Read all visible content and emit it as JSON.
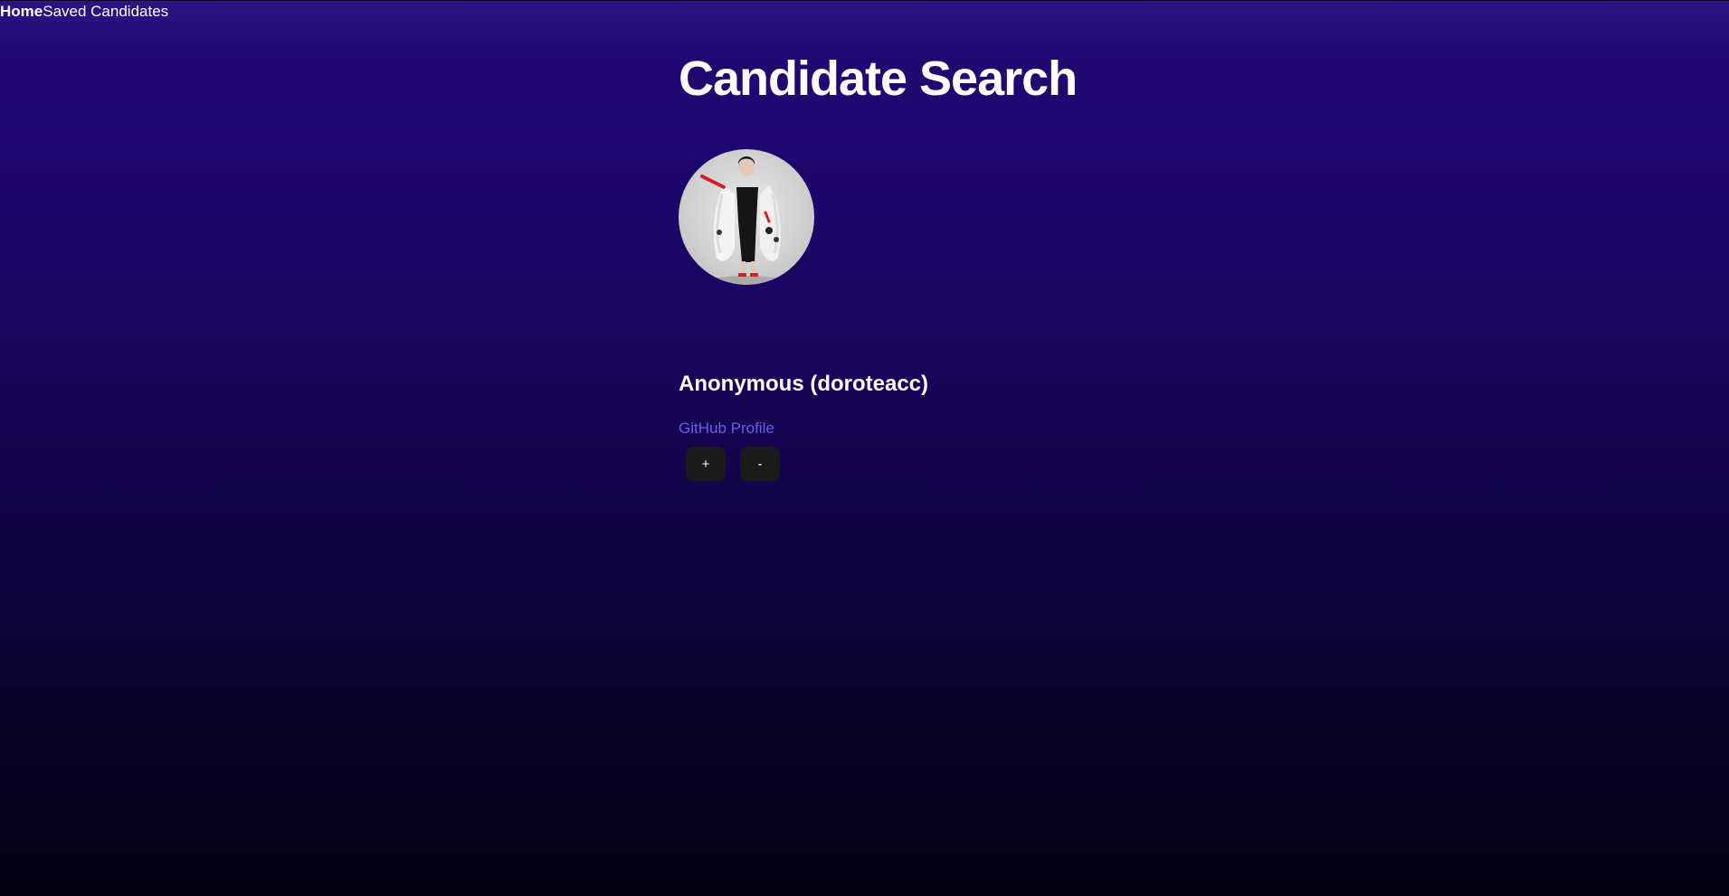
{
  "nav": {
    "home_label": "Home",
    "saved_label": "Saved Candidates"
  },
  "page": {
    "title": "Candidate Search"
  },
  "candidate": {
    "display_name": "Anonymous (doroteacc)",
    "profile_link_label": "GitHub Profile",
    "avatar_icon": "avatar-photo"
  },
  "actions": {
    "add_label": "+",
    "remove_label": "-"
  },
  "colors": {
    "background_top": "#2c1484",
    "background_bottom": "#040114",
    "link": "#6b5cf0",
    "button_bg": "#1a1a1a",
    "text": "#ffffff"
  }
}
